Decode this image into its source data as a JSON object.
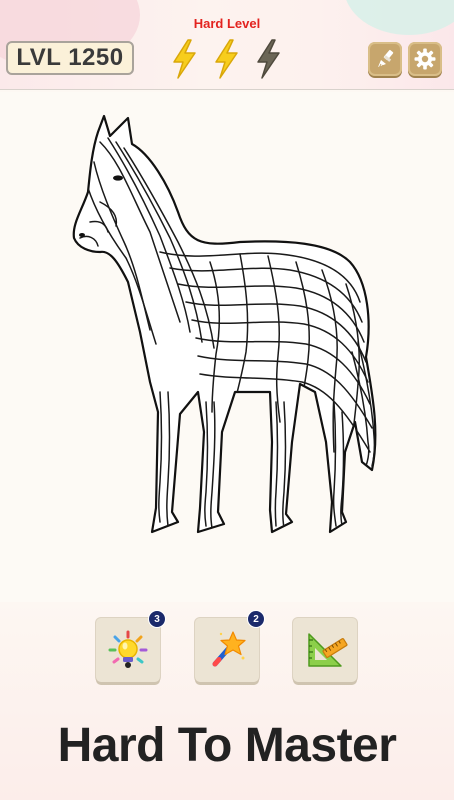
{
  "header": {
    "level_label": "LVL 1250",
    "difficulty_label": "Hard Level",
    "energy": {
      "filled": 2,
      "total": 3
    },
    "buttons": [
      {
        "name": "brush-button",
        "icon": "paint-brush-icon"
      },
      {
        "name": "settings-button",
        "icon": "gear-icon"
      }
    ]
  },
  "puzzle": {
    "subject": "horse-maze-drawing"
  },
  "tools": [
    {
      "name": "hint",
      "icon": "light-bulb-icon",
      "count": "3"
    },
    {
      "name": "magic-wand",
      "icon": "magic-wand-icon",
      "count": "2"
    },
    {
      "name": "ruler",
      "icon": "ruler-triangle-icon"
    }
  ],
  "footer": {
    "tagline": "Hard To Master"
  },
  "colors": {
    "difficulty_red": "#e3231f",
    "bolt_yellow": "#f7cd1c",
    "bolt_empty": "#6b6656",
    "button_gold": "#c7a66d",
    "badge_navy": "#1b2a6b"
  }
}
